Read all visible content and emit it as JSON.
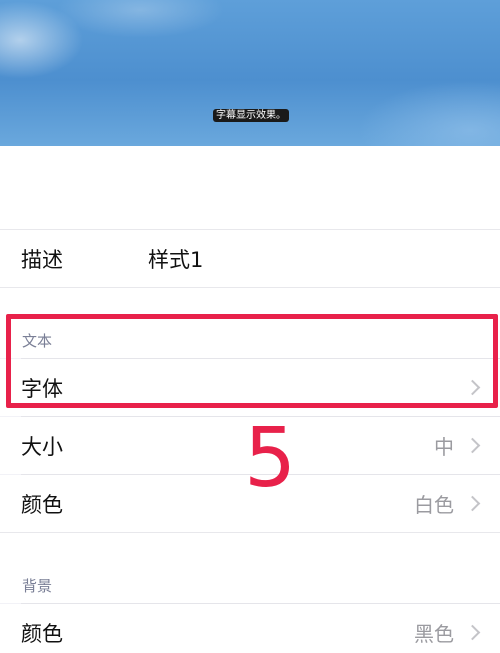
{
  "preview": {
    "caption_sample": "字幕显示效果。"
  },
  "description_row": {
    "label": "描述",
    "value": "样式1"
  },
  "text_section": {
    "header": "文本",
    "font_row": {
      "label": "字体"
    },
    "size_row": {
      "label": "大小",
      "value": "中"
    },
    "color_row": {
      "label": "颜色",
      "value": "白色"
    }
  },
  "background_section": {
    "header": "背景",
    "color_row": {
      "label": "颜色",
      "value": "黑色"
    }
  },
  "annotation": {
    "step_number": "5",
    "color": "#e8214a"
  }
}
